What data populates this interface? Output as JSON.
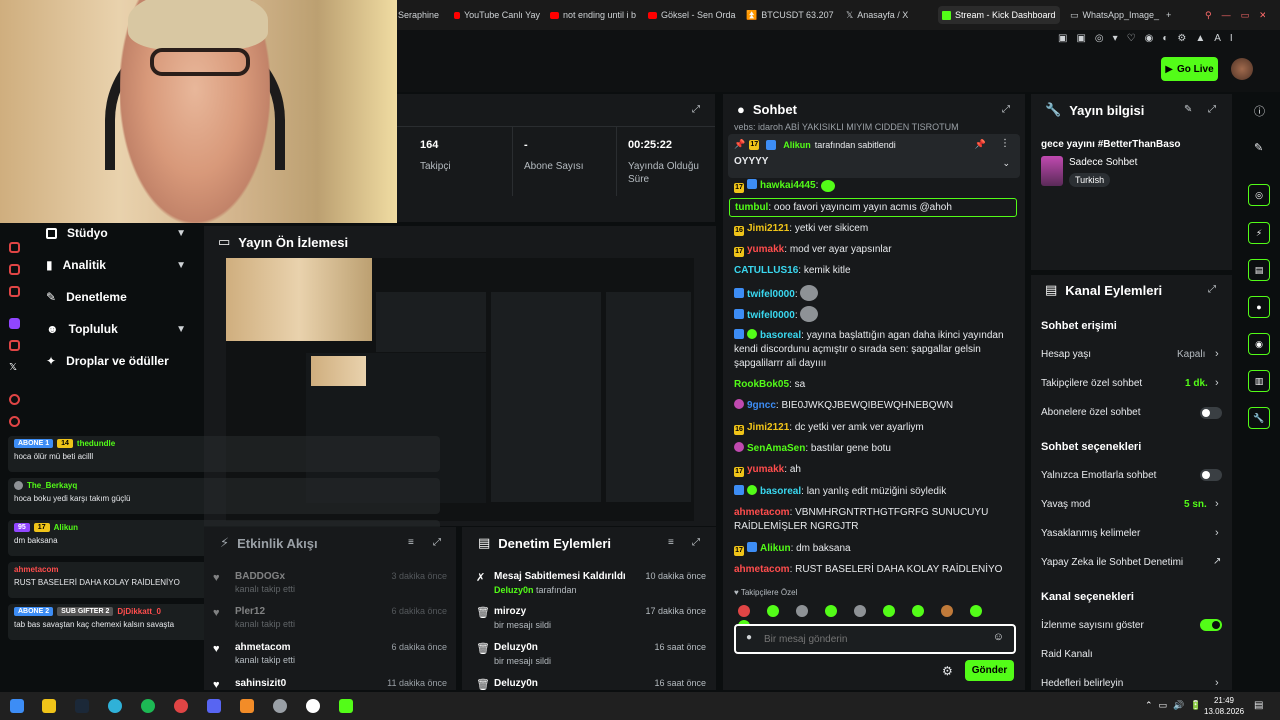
{
  "tabs": [
    {
      "label": "Seraphine",
      "icon": "page-icon"
    },
    {
      "label": "YouTube Canlı Yay",
      "icon": "youtube-icon"
    },
    {
      "label": "not ending until i b",
      "icon": "youtube-icon"
    },
    {
      "label": "Göksel - Sen Orda",
      "icon": "youtube-icon"
    },
    {
      "label": "BTCUSDT 63.207,",
      "icon": "chart-icon"
    },
    {
      "label": "Anasayfa / X",
      "icon": "x-icon"
    },
    {
      "label": "Stream - Kick Dashboard",
      "icon": "kick-icon"
    },
    {
      "label": "WhatsApp_Image_",
      "icon": "page-icon"
    }
  ],
  "topbar": {
    "go_live": "Go Live"
  },
  "nav": {
    "items": [
      {
        "label": "Stüdyo",
        "has_chevron": true
      },
      {
        "label": "Analitik",
        "has_chevron": true
      },
      {
        "label": "Denetleme",
        "has_chevron": false
      },
      {
        "label": "Topluluk",
        "has_chevron": true
      },
      {
        "label": "Droplar ve ödüller",
        "has_chevron": false
      }
    ]
  },
  "stats": [
    {
      "value": "164",
      "label": "Takipçi"
    },
    {
      "value": "-",
      "label": "Abone Sayısı"
    },
    {
      "value": "00:25:22",
      "label": "Yayında Olduğu Süre"
    }
  ],
  "preview": {
    "title": "Yayın Ön İzlemesi"
  },
  "overlay_chat": [
    {
      "badges": [
        "ABONE 1",
        "14"
      ],
      "user": "thedundle",
      "user_color": "#53fc18",
      "text": "hoca ölür mü beti acilll"
    },
    {
      "badges": [],
      "user": "The_Berkayq",
      "user_color": "#53fc18",
      "text": "hoca boku yedi karşı takım güçlü"
    },
    {
      "badges": [
        "95",
        "17"
      ],
      "user": "Alikun",
      "user_color": "#53fc18",
      "text": "dm baksana"
    },
    {
      "badges": [],
      "user": "ahmetacom",
      "user_color": "#ff4d4d",
      "text": "RUST BASELERİ DAHA KOLAY RAİDLENİYO"
    },
    {
      "badges": [
        "ABONE 2",
        "SUB GIFTER 2"
      ],
      "user": "DjDikkatt_0",
      "user_color": "#ff4d4d",
      "text": "tab bas savaştan kaç chemexi kalsın savaşta"
    }
  ],
  "activity": {
    "title": "Etkinlik Akışı",
    "items": [
      {
        "name": "BADDOGx",
        "sub": "kanalı takip etti",
        "time": "3 dakika önce"
      },
      {
        "name": "Pler12",
        "sub": "kanalı takip etti",
        "time": "6 dakika önce"
      },
      {
        "name": "ahmetacom",
        "sub": "kanalı takip etti",
        "time": "6 dakika önce"
      },
      {
        "name": "sahinsizit0",
        "sub": "",
        "time": "11 dakika önce"
      }
    ]
  },
  "modactions": {
    "title": "Denetim Eylemleri",
    "items": [
      {
        "name": "Mesaj Sabitlemesi Kaldırıldı",
        "by": "Deluzy0n",
        "sub": "tarafından",
        "time": "10 dakika önce",
        "icon": "unpin-icon"
      },
      {
        "name": "mirozy",
        "by": "",
        "sub": "bir mesajı sildi",
        "time": "17 dakika önce",
        "icon": "trash-icon"
      },
      {
        "name": "Deluzy0n",
        "by": "",
        "sub": "bir mesajı sildi",
        "time": "16 saat önce",
        "icon": "trash-icon"
      },
      {
        "name": "Deluzy0n",
        "by": "",
        "sub": "",
        "time": "16 saat önce",
        "icon": "trash-icon"
      }
    ]
  },
  "chat": {
    "title": "Sohbet",
    "pinned": {
      "by": "Alikun",
      "by_suffix": "tarafından sabitlendi",
      "text": "OYYYY",
      "badge": "17"
    },
    "partial_top": "vebs: idaroh ABİ YAKISIKLI MIYIM CIDDEN TISROTUM",
    "messages": [
      {
        "badges": [
          "17",
          "ver"
        ],
        "user": "hawkai4445",
        "color": "#53fc18",
        "text": "",
        "emote": true
      },
      {
        "badges": [],
        "user": "tumbul",
        "color": "#53fc18",
        "text": "ooo favori yayıncım yayın acmıs @ahoh",
        "highlight": true
      },
      {
        "badges": [
          "16"
        ],
        "user": "Jimi2121",
        "color": "#f0c419",
        "text": "yetki ver sikicem"
      },
      {
        "badges": [
          "17"
        ],
        "user": "yumakk",
        "color": "#ff4d4d",
        "text": "mod ver ayar yapsınlar"
      },
      {
        "badges": [],
        "user": "CATULLUS16",
        "color": "#3ad8f0",
        "text": "kemik kitle"
      },
      {
        "badges": [
          "ver"
        ],
        "user": "twifel0000",
        "color": "#3ad8f0",
        "text": "",
        "emote": true
      },
      {
        "badges": [
          "ver"
        ],
        "user": "twifel0000",
        "color": "#3ad8f0",
        "text": "",
        "emote": true
      },
      {
        "badges": [
          "ver",
          "mod"
        ],
        "user": "basoreal",
        "color": "#3ad8f0",
        "text": "yayına başlattığın agan daha ikinci yayından kendi discordunu açmıştır o sırada sen: şapgallar gelsin şapgalilarrr ali dayıııı"
      },
      {
        "badges": [],
        "user": "RookBok05",
        "color": "#53fc18",
        "text": "sa"
      },
      {
        "badges": [
          "pink"
        ],
        "user": "9gncc",
        "color": "#3d8df5",
        "text": "BIE0JWKQJBEWQIBEWQHNEBQWN"
      },
      {
        "badges": [
          "16"
        ],
        "user": "Jimi2121",
        "color": "#f0c419",
        "text": "dc yetki ver amk ver ayarliym"
      },
      {
        "badges": [
          "pink"
        ],
        "user": "SenAmaSen",
        "color": "#53fc18",
        "text": "bastılar gene botu"
      },
      {
        "badges": [
          "17"
        ],
        "user": "yumakk",
        "color": "#ff4d4d",
        "text": "ah"
      },
      {
        "badges": [
          "ver",
          "mod"
        ],
        "user": "basoreal",
        "color": "#3ad8f0",
        "text": "lan yanlış edit müziğini söyledik"
      },
      {
        "badges": [],
        "user": "ahmetacom",
        "color": "#ff4d4d",
        "text": "VBNMHRGNTRTHGTFGRFG SUNUCUYU RAİDLEMİŞLER NGRGJTR"
      },
      {
        "badges": [
          "17",
          "ver"
        ],
        "user": "Alikun",
        "color": "#53fc18",
        "text": "dm baksana"
      },
      {
        "badges": [],
        "user": "ahmetacom",
        "color": "#ff4d4d",
        "text": "RUST BASELERİ DAHA KOLAY RAİDLENİYO"
      }
    ],
    "followers_label": "Takipçilere Özel",
    "input_placeholder": "Bir mesaj gönderin",
    "send": "Gönder"
  },
  "info": {
    "title": "Yayın bilgisi",
    "stream_title": "gece yayını #BetterThanBaso",
    "category": "Sadece Sohbet",
    "language": "Turkish"
  },
  "channel_actions": {
    "title": "Kanal Eylemleri",
    "chat_access": "Sohbet erişimi",
    "rows_access": [
      {
        "label": "Hesap yaşı",
        "value": "Kapalı",
        "type": "chevron"
      },
      {
        "label": "Takipçilere özel sohbet",
        "value": "1 dk.",
        "type": "chevron-green"
      },
      {
        "label": "Abonelere özel sohbet",
        "value": "",
        "type": "toggle-off"
      }
    ],
    "chat_options": "Sohbet seçenekleri",
    "rows_options": [
      {
        "label": "Yalnızca Emotlarla sohbet",
        "value": "",
        "type": "toggle-off"
      },
      {
        "label": "Yavaş mod",
        "value": "5 sn.",
        "type": "chevron-green"
      },
      {
        "label": "Yasaklanmış kelimeler",
        "value": "",
        "type": "chevron"
      },
      {
        "label": "Yapay Zeka ile Sohbet Denetimi",
        "value": "",
        "type": "external"
      }
    ],
    "channel_options": "Kanal seçenekleri",
    "rows_channel": [
      {
        "label": "İzlenme sayısını göster",
        "value": "",
        "type": "toggle-on"
      },
      {
        "label": "Raid Kanalı",
        "value": "",
        "type": "none"
      },
      {
        "label": "Hedefleri belirleyin",
        "value": "",
        "type": "chevron"
      }
    ]
  },
  "clock": {
    "time": "21:49",
    "date": "13.08.2026"
  },
  "colors": {
    "brand": "#53fc18",
    "panel": "#17191b",
    "bg": "#0b0e0f"
  }
}
